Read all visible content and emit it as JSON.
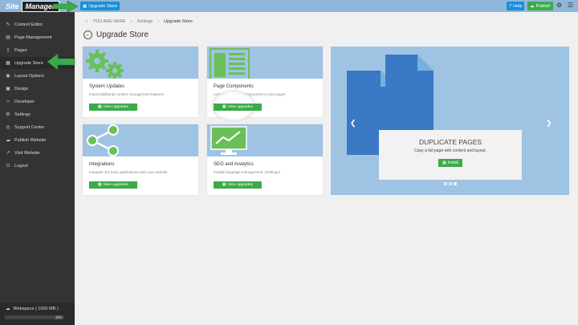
{
  "topbar": {
    "logo_site": "Site",
    "logo_manager": "Manager",
    "upgrade_store_label": "Upgrade Store",
    "help_label": "Help",
    "publish_label": "Publish"
  },
  "sidebar": {
    "items": [
      {
        "label": "Content Editor",
        "icon": "pencil-icon"
      },
      {
        "label": "Page Management",
        "icon": "file-icon"
      },
      {
        "label": "Pages",
        "icon": "file-icon"
      },
      {
        "label": "Upgrade Store",
        "icon": "grid-icon"
      },
      {
        "label": "Layout Options",
        "icon": "eye-icon"
      },
      {
        "label": "Design",
        "icon": "image-icon"
      },
      {
        "label": "Developer",
        "icon": "code-icon"
      },
      {
        "label": "Settings",
        "icon": "gear-icon"
      },
      {
        "label": "Support Center",
        "icon": "lifebuoy-icon"
      },
      {
        "label": "Publish Website",
        "icon": "cloud-icon"
      },
      {
        "label": "Visit Website",
        "icon": "external-link-icon"
      },
      {
        "label": "Logout",
        "icon": "power-icon"
      }
    ],
    "workspace_label": "Webspace ( 1000 MB )",
    "workspace_pct": "0%",
    "workspace_progress": 0
  },
  "breadcrumb": {
    "you_are_here": "YOU ARE HERE",
    "settings": "Settings",
    "current": "Upgrade Store"
  },
  "page_title": "Upgrade Store",
  "cards": [
    {
      "title": "System Updates",
      "desc": "Install additional content management features",
      "button": "View upgrades",
      "image": "gears-icon"
    },
    {
      "title": "Page Components",
      "desc": "Add extra content components to your pages",
      "button": "View upgrades",
      "image": "document-layout-icon"
    },
    {
      "title": "Integrations",
      "desc": "Integrate 3rd party applications with your website",
      "button": "View upgrades",
      "image": "share-icon"
    },
    {
      "title": "SEO and Analytics",
      "desc": "Installs language management. (Settings)",
      "button": "View upgrades",
      "image": "monitor-chart-icon"
    }
  ],
  "carousel": {
    "title": "DUPLICATE PAGES",
    "desc": "Copy a full page with content and layout.",
    "button": "Install",
    "active_slide": 3,
    "slide_count": 3
  },
  "colors": {
    "accent_blue": "#1a8fd6",
    "green": "#3daa4a",
    "light_blue": "#9ec3e3",
    "sidebar": "#333333"
  }
}
